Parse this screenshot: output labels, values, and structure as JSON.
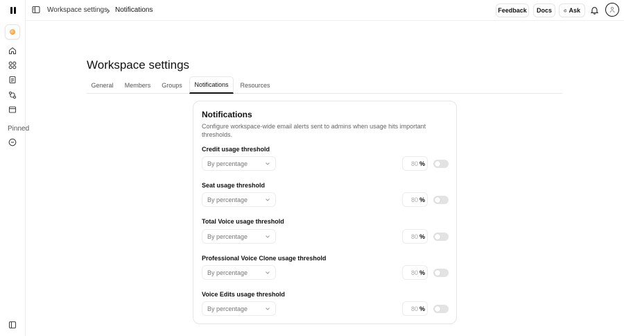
{
  "sidebar": {
    "pinned_label": "Pinned"
  },
  "breadcrumb": {
    "parent": "Workspace settings",
    "current": "Notifications"
  },
  "topbar": {
    "feedback_label": "Feedback",
    "docs_label": "Docs",
    "ask_label": "Ask"
  },
  "page": {
    "title": "Workspace settings"
  },
  "tabs": [
    {
      "label": "General"
    },
    {
      "label": "Members"
    },
    {
      "label": "Groups"
    },
    {
      "label": "Notifications",
      "active": true
    },
    {
      "label": "Resources"
    }
  ],
  "card": {
    "title": "Notifications",
    "description": "Configure workspace-wide email alerts sent to admins when usage hits important thresholds.",
    "thresholds": [
      {
        "label": "Credit usage threshold",
        "mode": "By percentage",
        "value": "80",
        "unit": "%",
        "enabled": false
      },
      {
        "label": "Seat usage threshold",
        "mode": "By percentage",
        "value": "80",
        "unit": "%",
        "enabled": false
      },
      {
        "label": "Total Voice usage threshold",
        "mode": "By percentage",
        "value": "80",
        "unit": "%",
        "enabled": false
      },
      {
        "label": "Professional Voice Clone usage threshold",
        "mode": "By percentage",
        "value": "80",
        "unit": "%",
        "enabled": false
      },
      {
        "label": "Voice Edits usage threshold",
        "mode": "By percentage",
        "value": "80",
        "unit": "%",
        "enabled": false
      }
    ]
  },
  "colors": {
    "accent": "#111111",
    "brand_orb": "#f0861d",
    "toggle_off": "#e3e3e3"
  }
}
